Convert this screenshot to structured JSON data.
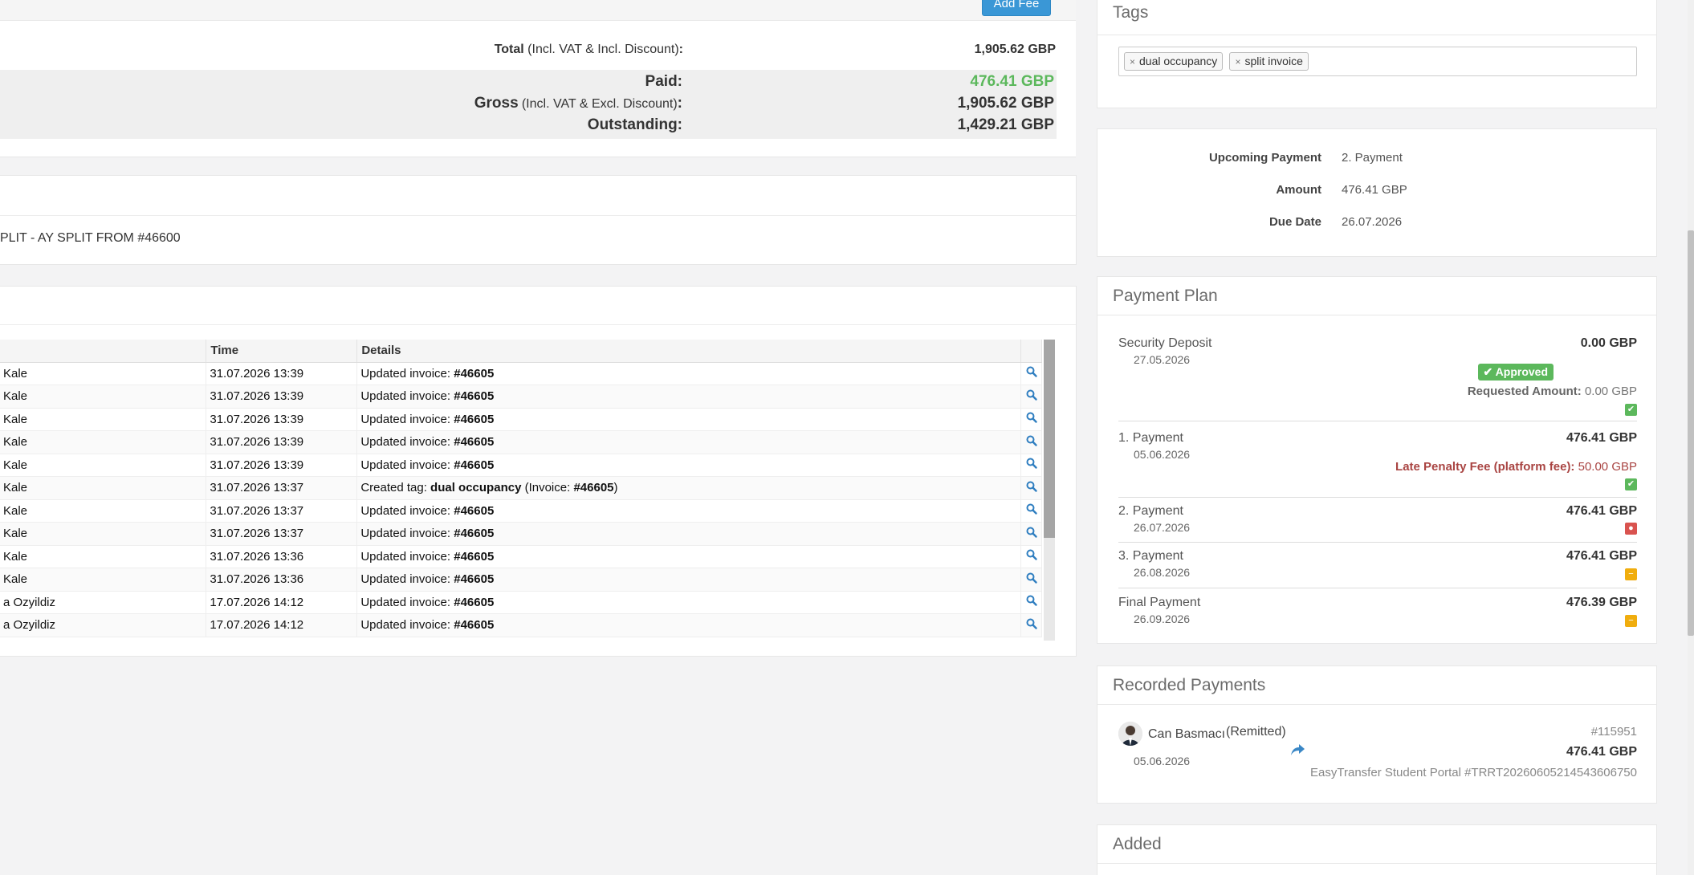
{
  "totals": {
    "add_fee_label": "Add Fee",
    "total_label": "Total",
    "total_note": "(Incl. VAT & Incl. Discount)",
    "total_value": "1,905.62 GBP",
    "paid_label": "Paid:",
    "paid_value": "476.41 GBP",
    "gross_label": "Gross",
    "gross_note": "(Incl. VAT & Excl. Discount)",
    "gross_value": "1,905.62 GBP",
    "outstanding_label": "Outstanding:",
    "outstanding_value": "1,429.21 GBP",
    "colon": ":"
  },
  "notes": {
    "text": "PLIT - AY SPLIT FROM #46600"
  },
  "log": {
    "columns": [
      "",
      "Time",
      "Details"
    ],
    "rows": [
      {
        "user": "Kale",
        "time": "31.07.2026 13:39",
        "prefix": "Updated invoice: ",
        "bold": "#46605",
        "suffix": ""
      },
      {
        "user": "Kale",
        "time": "31.07.2026 13:39",
        "prefix": "Updated invoice: ",
        "bold": "#46605",
        "suffix": ""
      },
      {
        "user": "Kale",
        "time": "31.07.2026 13:39",
        "prefix": "Updated invoice: ",
        "bold": "#46605",
        "suffix": ""
      },
      {
        "user": "Kale",
        "time": "31.07.2026 13:39",
        "prefix": "Updated invoice: ",
        "bold": "#46605",
        "suffix": ""
      },
      {
        "user": "Kale",
        "time": "31.07.2026 13:39",
        "prefix": "Updated invoice: ",
        "bold": "#46605",
        "suffix": ""
      },
      {
        "user": "Kale",
        "time": "31.07.2026 13:37",
        "prefix": "Created tag: ",
        "bold": "dual occupancy",
        "suffix": " (Invoice: ",
        "bold2": "#46605",
        "suffix2": ")"
      },
      {
        "user": "Kale",
        "time": "31.07.2026 13:37",
        "prefix": "Updated invoice: ",
        "bold": "#46605",
        "suffix": ""
      },
      {
        "user": "Kale",
        "time": "31.07.2026 13:37",
        "prefix": "Updated invoice: ",
        "bold": "#46605",
        "suffix": ""
      },
      {
        "user": "Kale",
        "time": "31.07.2026 13:36",
        "prefix": "Updated invoice: ",
        "bold": "#46605",
        "suffix": ""
      },
      {
        "user": "Kale",
        "time": "31.07.2026 13:36",
        "prefix": "Updated invoice: ",
        "bold": "#46605",
        "suffix": ""
      },
      {
        "user": "a Ozyildiz",
        "time": "17.07.2026 14:12",
        "prefix": "Updated invoice: ",
        "bold": "#46605",
        "suffix": ""
      },
      {
        "user": "a Ozyildiz",
        "time": "17.07.2026 14:12",
        "prefix": "Updated invoice: ",
        "bold": "#46605",
        "suffix": ""
      }
    ],
    "view_icon": "magnifier-icon"
  },
  "tags": {
    "title": "Tags",
    "items": [
      "dual occupancy",
      "split invoice"
    ],
    "remove_glyph": "×"
  },
  "upcoming": {
    "payment_label": "Upcoming Payment",
    "payment_value": "2. Payment",
    "amount_label": "Amount",
    "amount_value": "476.41 GBP",
    "due_label": "Due Date",
    "due_value": "26.07.2026"
  },
  "plan": {
    "title": "Payment Plan",
    "deposit": {
      "name": "Security Deposit",
      "date": "27.05.2026",
      "amount": "0.00 GBP",
      "approved_label": "Approved",
      "requested_label": "Requested Amount:",
      "requested_value": "0.00 GBP"
    },
    "p1": {
      "name": "1. Payment",
      "date": "05.06.2026",
      "amount": "476.41 GBP",
      "late_label": "Late Penalty Fee (platform fee):",
      "late_value": "50.00 GBP",
      "status": "paid"
    },
    "p2": {
      "name": "2. Payment",
      "date": "26.07.2026",
      "amount": "476.41 GBP",
      "status": "overdue"
    },
    "p3": {
      "name": "3. Payment",
      "date": "26.08.2026",
      "amount": "476.41 GBP",
      "status": "pending"
    },
    "final": {
      "name": "Final Payment",
      "date": "26.09.2026",
      "amount": "476.39 GBP",
      "status": "pending"
    },
    "status_colors": {
      "paid": "#5cb85c",
      "overdue": "#d9534f",
      "pending": "#f0ad0e"
    }
  },
  "recorded": {
    "title": "Recorded Payments",
    "name": "Can Basmacı",
    "status": "(Remitted)",
    "date": "05.06.2026",
    "id": "#115951",
    "amount": "476.41 GBP",
    "reference": "EasyTransfer Student Portal #TRRT20260605214543606750"
  },
  "added": {
    "title": "Added"
  },
  "colors": {
    "accent": "#3a97d6",
    "success": "#5cb85c",
    "danger": "#a94442"
  }
}
